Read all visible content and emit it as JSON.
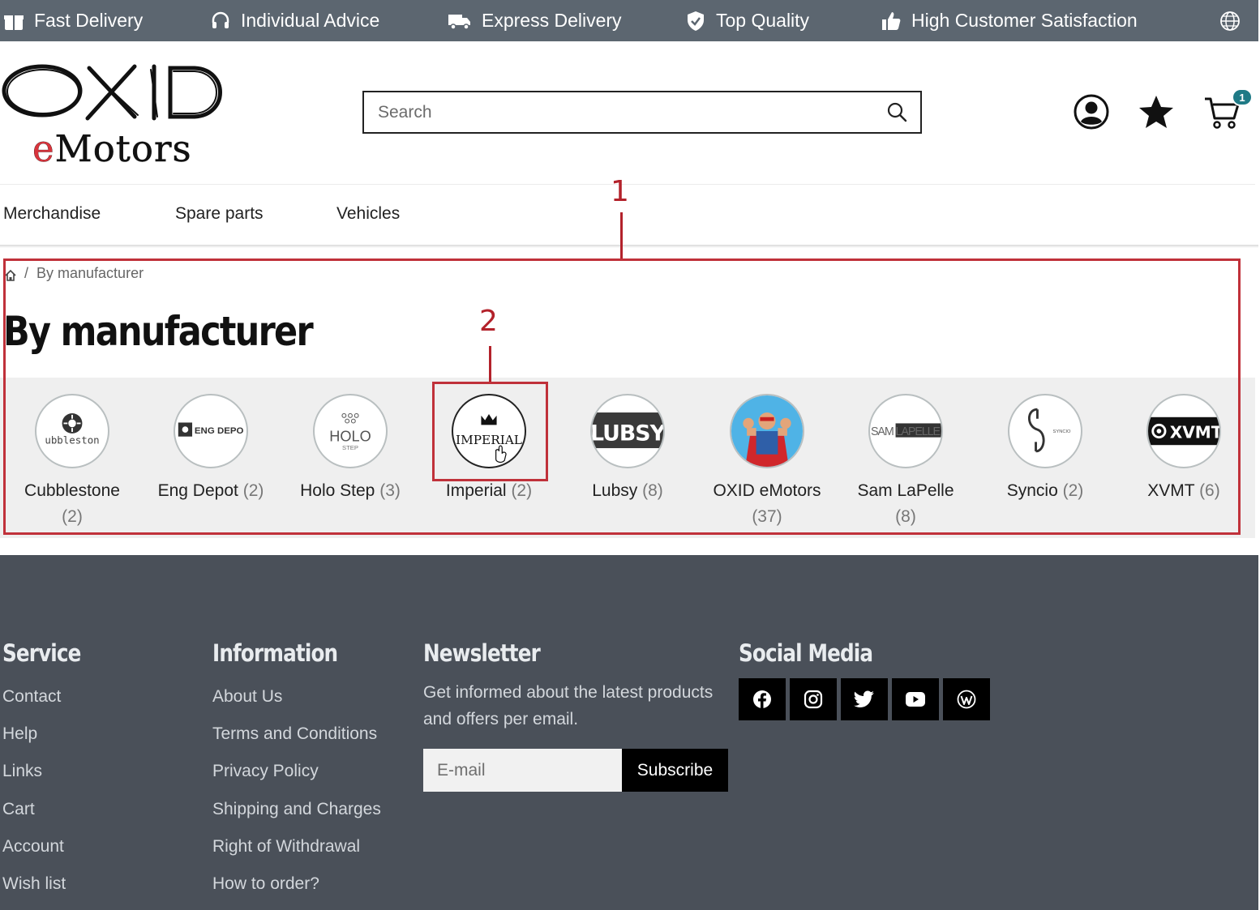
{
  "topbar": {
    "usps": [
      {
        "label": "Fast Delivery",
        "icon": "gift-icon"
      },
      {
        "label": "Individual Advice",
        "icon": "headset-icon"
      },
      {
        "label": "Express Delivery",
        "icon": "truck-icon"
      },
      {
        "label": "Top Quality",
        "icon": "shield-check-icon"
      },
      {
        "label": "High Customer Satisfaction",
        "icon": "thumbs-up-icon"
      }
    ],
    "language_icon": "globe-icon"
  },
  "header": {
    "logo_line1": "OXID",
    "logo_line2": "eMotors",
    "search_placeholder": "Search",
    "cart_count": "1"
  },
  "nav": {
    "items": [
      "Merchandise",
      "Spare parts",
      "Vehicles"
    ]
  },
  "breadcrumb": {
    "current": "By manufacturer"
  },
  "page_title": "By manufacturer",
  "manufacturers": [
    {
      "name": "Cubblestone",
      "count": "(2)",
      "logo_text": "ubbleston"
    },
    {
      "name": "Eng Depot",
      "count": "(2)",
      "logo_text": "ENG DEPO"
    },
    {
      "name": "Holo Step",
      "count": "(3)",
      "logo_text": "HOLO"
    },
    {
      "name": "Imperial",
      "count": "(2)",
      "logo_text": "IMPERIAL"
    },
    {
      "name": "Lubsy",
      "count": "(8)",
      "logo_text": "LUBSY"
    },
    {
      "name": "OXID eMotors",
      "count": "(37)",
      "logo_text": ""
    },
    {
      "name": "Sam LaPelle",
      "count": "(8)",
      "logo_text": "SAM LAPELLE"
    },
    {
      "name": "Syncio",
      "count": "(2)",
      "logo_text": "SYNCIO"
    },
    {
      "name": "XVMT",
      "count": "(6)",
      "logo_text": "XVMT"
    }
  ],
  "annotations": {
    "label1": "1",
    "label2": "2"
  },
  "footer": {
    "service": {
      "heading": "Service",
      "links": [
        "Contact",
        "Help",
        "Links",
        "Cart",
        "Account",
        "Wish list"
      ]
    },
    "information": {
      "heading": "Information",
      "links": [
        "About Us",
        "Terms and Conditions",
        "Privacy Policy",
        "Shipping and Charges",
        "Right of Withdrawal",
        "How to order?"
      ]
    },
    "newsletter": {
      "heading": "Newsletter",
      "text": "Get informed about the latest products and offers per email.",
      "email_placeholder": "E-mail",
      "button": "Subscribe"
    },
    "social": {
      "heading": "Social Media",
      "icons": [
        "facebook-icon",
        "instagram-icon",
        "twitter-icon",
        "youtube-icon",
        "wordpress-icon"
      ]
    }
  },
  "colors": {
    "topbar": "#5c6670",
    "footer": "#4a5059",
    "annotation": "#c0313a",
    "badge": "#1f7a86",
    "logo_red": "#d8343c"
  }
}
